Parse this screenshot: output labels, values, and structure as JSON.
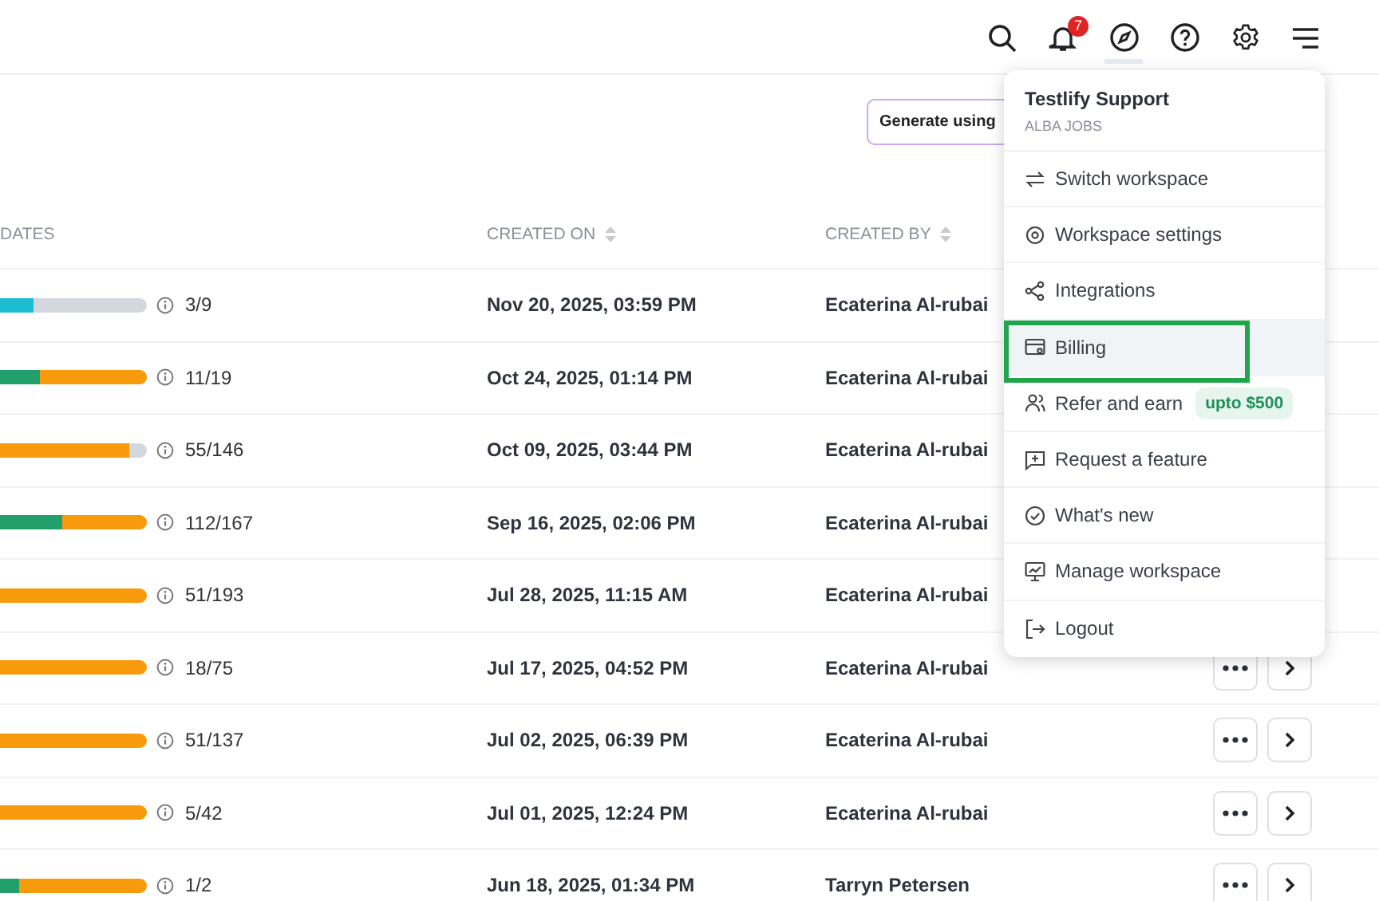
{
  "topbar": {
    "icons": [
      {
        "kind": "search",
        "selected": false
      },
      {
        "kind": "bell",
        "selected": false,
        "badge": "7"
      },
      {
        "kind": "compass",
        "selected": true
      },
      {
        "kind": "help",
        "selected": false
      },
      {
        "kind": "settings",
        "selected": false
      },
      {
        "kind": "menu",
        "selected": false
      }
    ]
  },
  "generate_button": "Generate using",
  "table": {
    "columns": [
      {
        "label": "DATES",
        "sortable": false
      },
      {
        "label": "CREATED ON",
        "sortable": true
      },
      {
        "label": "CREATED BY",
        "sortable": true
      }
    ],
    "rows": [
      {
        "segments": [
          {
            "color": "#1cbcd2",
            "level": 0.49
          }
        ],
        "count": "3/9",
        "created_on": "Nov 20, 2025, 03:59 PM",
        "created_by": "Ecaterina Al-rubai",
        "actions": false
      },
      {
        "segments": [
          {
            "color": "#22a06b",
            "level": 0.52
          },
          {
            "color": "#f79a0c",
            "level": 0.48
          }
        ],
        "count": "11/19",
        "created_on": "Oct 24, 2025, 01:14 PM",
        "created_by": "Ecaterina Al-rubai",
        "actions": false
      },
      {
        "segments": [
          {
            "color": "#f79a0c",
            "level": 0.92
          }
        ],
        "count": "55/146",
        "created_on": "Oct 09, 2025, 03:44 PM",
        "created_by": "Ecaterina Al-rubai",
        "actions": false
      },
      {
        "segments": [
          {
            "color": "#22a06b",
            "level": 0.62
          },
          {
            "color": "#f79a0c",
            "level": 0.38
          }
        ],
        "count": "112/167",
        "created_on": "Sep 16, 2025, 02:06 PM",
        "created_by": "Ecaterina Al-rubai",
        "actions": false
      },
      {
        "segments": [
          {
            "color": "#f79a0c",
            "level": 1
          }
        ],
        "count": "51/193",
        "created_on": "Jul 28, 2025, 11:15 AM",
        "created_by": "Ecaterina Al-rubai",
        "actions": false
      },
      {
        "segments": [
          {
            "color": "#f79a0c",
            "level": 1
          }
        ],
        "count": "18/75",
        "created_on": "Jul 17, 2025, 04:52 PM",
        "created_by": "Ecaterina Al-rubai",
        "actions": true
      },
      {
        "segments": [
          {
            "color": "#f79a0c",
            "level": 1
          }
        ],
        "count": "51/137",
        "created_on": "Jul 02, 2025, 06:39 PM",
        "created_by": "Ecaterina Al-rubai",
        "actions": true
      },
      {
        "segments": [
          {
            "color": "#f79a0c",
            "level": 1
          }
        ],
        "count": "5/42",
        "created_on": "Jul 01, 2025, 12:24 PM",
        "created_by": "Ecaterina Al-rubai",
        "actions": true
      },
      {
        "segments": [
          {
            "color": "#22a06b",
            "level": 0.43
          },
          {
            "color": "#f79a0c",
            "level": 0.57
          }
        ],
        "count": "1/2",
        "created_on": "Jun 18, 2025, 01:34 PM",
        "created_by": "Tarryn Petersen",
        "actions": true
      }
    ]
  },
  "dropdown": {
    "name": "Testlify Support",
    "workspace": "ALBA JOBS",
    "items": [
      {
        "kind": "switch",
        "label": "Switch workspace",
        "selected": false,
        "annotated": false
      },
      {
        "kind": "settings",
        "label": "Workspace settings",
        "selected": false,
        "annotated": false
      },
      {
        "kind": "integrations",
        "label": "Integrations",
        "selected": false,
        "annotated": false
      },
      {
        "kind": "billing",
        "label": "Billing",
        "selected": true,
        "annotated": true
      },
      {
        "kind": "refer",
        "label": "Refer and earn",
        "badge": "upto $500",
        "selected": false,
        "annotated": false
      },
      {
        "kind": "request",
        "label": "Request a feature",
        "selected": false,
        "annotated": false
      },
      {
        "kind": "whatsnew",
        "label": "What's new",
        "selected": false,
        "annotated": false
      },
      {
        "kind": "manage",
        "label": "Manage workspace",
        "selected": false,
        "annotated": false
      },
      {
        "kind": "logout",
        "label": "Logout",
        "selected": false,
        "annotated": false
      }
    ]
  }
}
